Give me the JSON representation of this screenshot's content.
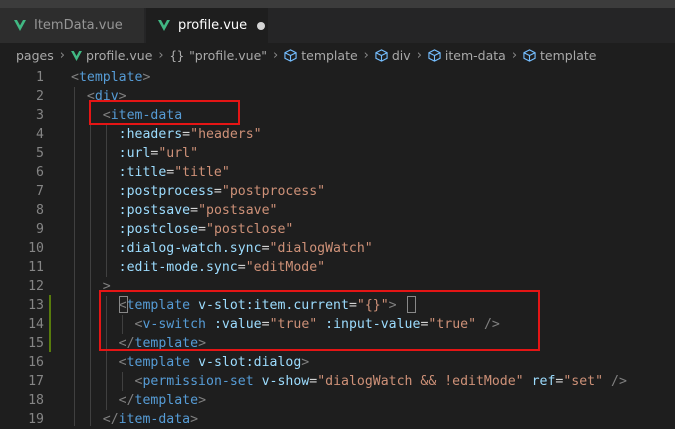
{
  "tabs": [
    {
      "label": "ItemData.vue",
      "active": false,
      "icon": "vue-icon"
    },
    {
      "label": "profile.vue",
      "active": true,
      "icon": "vue-icon",
      "dirty": true
    }
  ],
  "breadcrumbs": [
    {
      "label": "pages",
      "icon": ""
    },
    {
      "label": "profile.vue",
      "icon": "vue-icon"
    },
    {
      "label": "\"profile.vue\"",
      "icon": "braces-icon"
    },
    {
      "label": "template",
      "icon": "cube-icon"
    },
    {
      "label": "div",
      "icon": "cube-icon"
    },
    {
      "label": "item-data",
      "icon": "cube-icon"
    },
    {
      "label": "template",
      "icon": "cube-icon"
    }
  ],
  "lines": [
    {
      "n": "1",
      "t": [
        [
          "b",
          "<"
        ],
        [
          "g",
          "template"
        ],
        [
          "b",
          ">"
        ]
      ]
    },
    {
      "n": "2",
      "t": [
        [
          "x",
          "  "
        ],
        [
          "b",
          "<"
        ],
        [
          "g",
          "div"
        ],
        [
          "b",
          ">"
        ]
      ]
    },
    {
      "n": "3",
      "t": [
        [
          "x",
          "    "
        ],
        [
          "b",
          "<"
        ],
        [
          "g",
          "item-data"
        ]
      ]
    },
    {
      "n": "4",
      "t": [
        [
          "x",
          "      "
        ],
        [
          "a",
          ":headers"
        ],
        [
          "e",
          "="
        ],
        [
          "s",
          "\"headers\""
        ]
      ]
    },
    {
      "n": "5",
      "t": [
        [
          "x",
          "      "
        ],
        [
          "a",
          ":url"
        ],
        [
          "e",
          "="
        ],
        [
          "s",
          "\"url\""
        ]
      ]
    },
    {
      "n": "6",
      "t": [
        [
          "x",
          "      "
        ],
        [
          "a",
          ":title"
        ],
        [
          "e",
          "="
        ],
        [
          "s",
          "\"title\""
        ]
      ]
    },
    {
      "n": "7",
      "t": [
        [
          "x",
          "      "
        ],
        [
          "a",
          ":postprocess"
        ],
        [
          "e",
          "="
        ],
        [
          "s",
          "\"postprocess\""
        ]
      ]
    },
    {
      "n": "8",
      "t": [
        [
          "x",
          "      "
        ],
        [
          "a",
          ":postsave"
        ],
        [
          "e",
          "="
        ],
        [
          "s",
          "\"postsave\""
        ]
      ]
    },
    {
      "n": "9",
      "t": [
        [
          "x",
          "      "
        ],
        [
          "a",
          ":postclose"
        ],
        [
          "e",
          "="
        ],
        [
          "s",
          "\"postclose\""
        ]
      ]
    },
    {
      "n": "10",
      "t": [
        [
          "x",
          "      "
        ],
        [
          "a",
          ":dialog-watch.sync"
        ],
        [
          "e",
          "="
        ],
        [
          "s",
          "\"dialogWatch\""
        ]
      ]
    },
    {
      "n": "11",
      "t": [
        [
          "x",
          "      "
        ],
        [
          "a",
          ":edit-mode.sync"
        ],
        [
          "e",
          "="
        ],
        [
          "s",
          "\"editMode\""
        ]
      ]
    },
    {
      "n": "12",
      "t": [
        [
          "x",
          "    "
        ],
        [
          "b",
          ">"
        ]
      ]
    },
    {
      "n": "13",
      "t": [
        [
          "x",
          "      "
        ],
        [
          "b",
          "<"
        ],
        [
          "g",
          "template"
        ],
        [
          "x",
          " "
        ],
        [
          "a",
          "v-slot:item.current"
        ],
        [
          "e",
          "="
        ],
        [
          "s",
          "\"{}\""
        ],
        [
          "b",
          ">"
        ]
      ]
    },
    {
      "n": "14",
      "t": [
        [
          "x",
          "        "
        ],
        [
          "b",
          "<"
        ],
        [
          "g",
          "v-switch"
        ],
        [
          "x",
          " "
        ],
        [
          "a",
          ":value"
        ],
        [
          "e",
          "="
        ],
        [
          "s",
          "\"true\""
        ],
        [
          "x",
          " "
        ],
        [
          "a",
          ":input-value"
        ],
        [
          "e",
          "="
        ],
        [
          "s",
          "\"true\""
        ],
        [
          "x",
          " "
        ],
        [
          "b",
          "/>"
        ]
      ]
    },
    {
      "n": "15",
      "t": [
        [
          "x",
          "      "
        ],
        [
          "b",
          "</"
        ],
        [
          "g",
          "template"
        ],
        [
          "b",
          ">"
        ]
      ]
    },
    {
      "n": "16",
      "t": [
        [
          "x",
          "      "
        ],
        [
          "b",
          "<"
        ],
        [
          "g",
          "template"
        ],
        [
          "x",
          " "
        ],
        [
          "a",
          "v-slot:dialog"
        ],
        [
          "b",
          ">"
        ]
      ]
    },
    {
      "n": "17",
      "t": [
        [
          "x",
          "        "
        ],
        [
          "b",
          "<"
        ],
        [
          "g",
          "permission-set"
        ],
        [
          "x",
          " "
        ],
        [
          "a",
          "v-show"
        ],
        [
          "e",
          "="
        ],
        [
          "s",
          "\"dialogWatch && !editMode\""
        ],
        [
          "x",
          " "
        ],
        [
          "a",
          "ref"
        ],
        [
          "e",
          "="
        ],
        [
          "s",
          "\"set\""
        ],
        [
          "x",
          " "
        ],
        [
          "b",
          "/>"
        ]
      ]
    },
    {
      "n": "18",
      "t": [
        [
          "x",
          "      "
        ],
        [
          "b",
          "</"
        ],
        [
          "g",
          "template"
        ],
        [
          "b",
          ">"
        ]
      ]
    },
    {
      "n": "19",
      "t": [
        [
          "x",
          "    "
        ],
        [
          "b",
          "</"
        ],
        [
          "g",
          "item-data"
        ],
        [
          "b",
          ">"
        ]
      ]
    }
  ],
  "colors": {
    "tag": "#569cd6",
    "attr": "#9cdcfe",
    "string": "#ce9178",
    "bracket": "#808080",
    "highlight": "#e51515",
    "git_modified": "#587c0c"
  }
}
